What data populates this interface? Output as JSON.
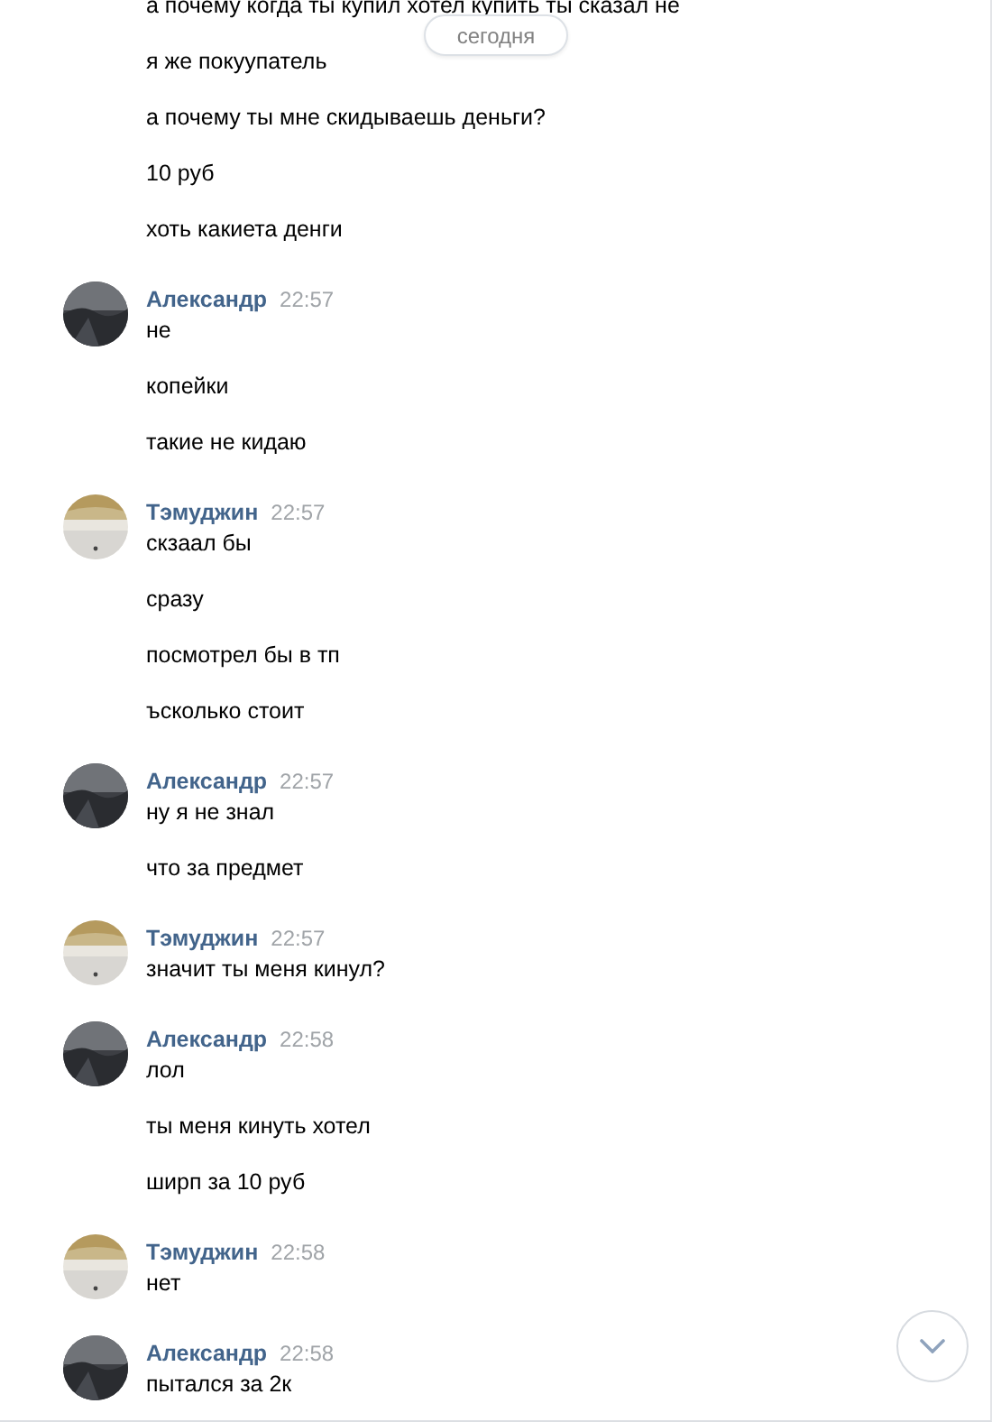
{
  "date_pill": "сегодня",
  "groups": [
    {
      "messages": [
        "а почему когда ты купил хотел купить ты сказал не",
        "я же покуупатель",
        "а почему ты мне скидываешь деньги?",
        "10 руб",
        "хоть какиета денги"
      ]
    },
    {
      "author": "Александр",
      "time": "22:57",
      "avatar": {
        "kind": "picture"
      },
      "messages": [
        "не",
        "копейки",
        "такие не кидаю"
      ]
    },
    {
      "author": "Тэмуджин",
      "time": "22:57",
      "avatar": {
        "kind": "picture"
      },
      "messages": [
        "скзаал бы",
        "сразу",
        "посмотрел бы в тп",
        "ъсколько стоит"
      ]
    },
    {
      "author": "Александр",
      "time": "22:57",
      "avatar": {
        "kind": "picture"
      },
      "messages": [
        "ну я не знал",
        "что за предмет"
      ]
    },
    {
      "author": "Тэмуджин",
      "time": "22:57",
      "avatar": {
        "kind": "picture"
      },
      "messages": [
        "значит ты меня кинул?"
      ]
    },
    {
      "author": "Александр",
      "time": "22:58",
      "avatar": {
        "kind": "picture"
      },
      "messages": [
        "лол",
        "ты меня кинуть хотел",
        "ширп за 10 руб"
      ]
    },
    {
      "author": "Тэмуджин",
      "time": "22:58",
      "avatar": {
        "kind": "picture"
      },
      "messages": [
        "нет"
      ]
    },
    {
      "author": "Александр",
      "time": "22:58",
      "avatar": {
        "kind": "picture"
      },
      "messages": [
        "пытался за 2к"
      ]
    }
  ]
}
